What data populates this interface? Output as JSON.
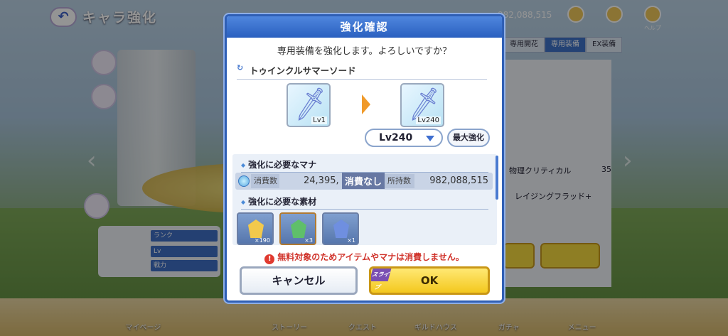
{
  "screen": {
    "title": "キャラ強化",
    "mana_display": "982,088,515",
    "top_icons": [
      {
        "name": "shop-icon",
        "label": ""
      },
      {
        "name": "help-icon",
        "label": ""
      },
      {
        "name": "question-icon",
        "label": "ヘルプ"
      }
    ],
    "right_tabs": [
      "専用開花",
      "専用装備",
      "EX装備"
    ],
    "right_rows": {
      "crit_label": "物理クリティカル",
      "crit_value": "35",
      "skill_name": "レイジングフラッド+"
    },
    "left_labels": [
      "ランク",
      "Lv",
      "戦力"
    ],
    "bottom_nav": [
      "マイページ",
      "",
      "ストーリー",
      "クエスト",
      "ギルドハウス",
      "ガチャ",
      "メニュー"
    ]
  },
  "dialog": {
    "header": "強化確認",
    "message": "専用装備を強化します。よろしいですか？",
    "item_name": "トゥインクルサマーソード",
    "from_level": "Lv1",
    "to_level": "Lv240",
    "level_select": "Lv240",
    "max_button": "最大強化",
    "mana_section": "強化に必要なマナ",
    "mana_cost_label": "消費数",
    "mana_cost_value": "24,395,",
    "mana_none_overlay": "消費なし",
    "mana_own_label": "所持数",
    "mana_own_value": "982,088,515",
    "materials_section": "強化に必要な素材",
    "materials": [
      {
        "color": "#f2c94c",
        "count": "×190"
      },
      {
        "color": "#5fbf6a",
        "count": "×3"
      },
      {
        "color": "#6f8fe0",
        "count": "×1"
      }
    ],
    "warning": "無料対象のためアイテムやマナは消費しません。",
    "warning_icon": "!",
    "cancel": "キャンセル",
    "ok": "OK",
    "skip_badge": "スライブ"
  }
}
